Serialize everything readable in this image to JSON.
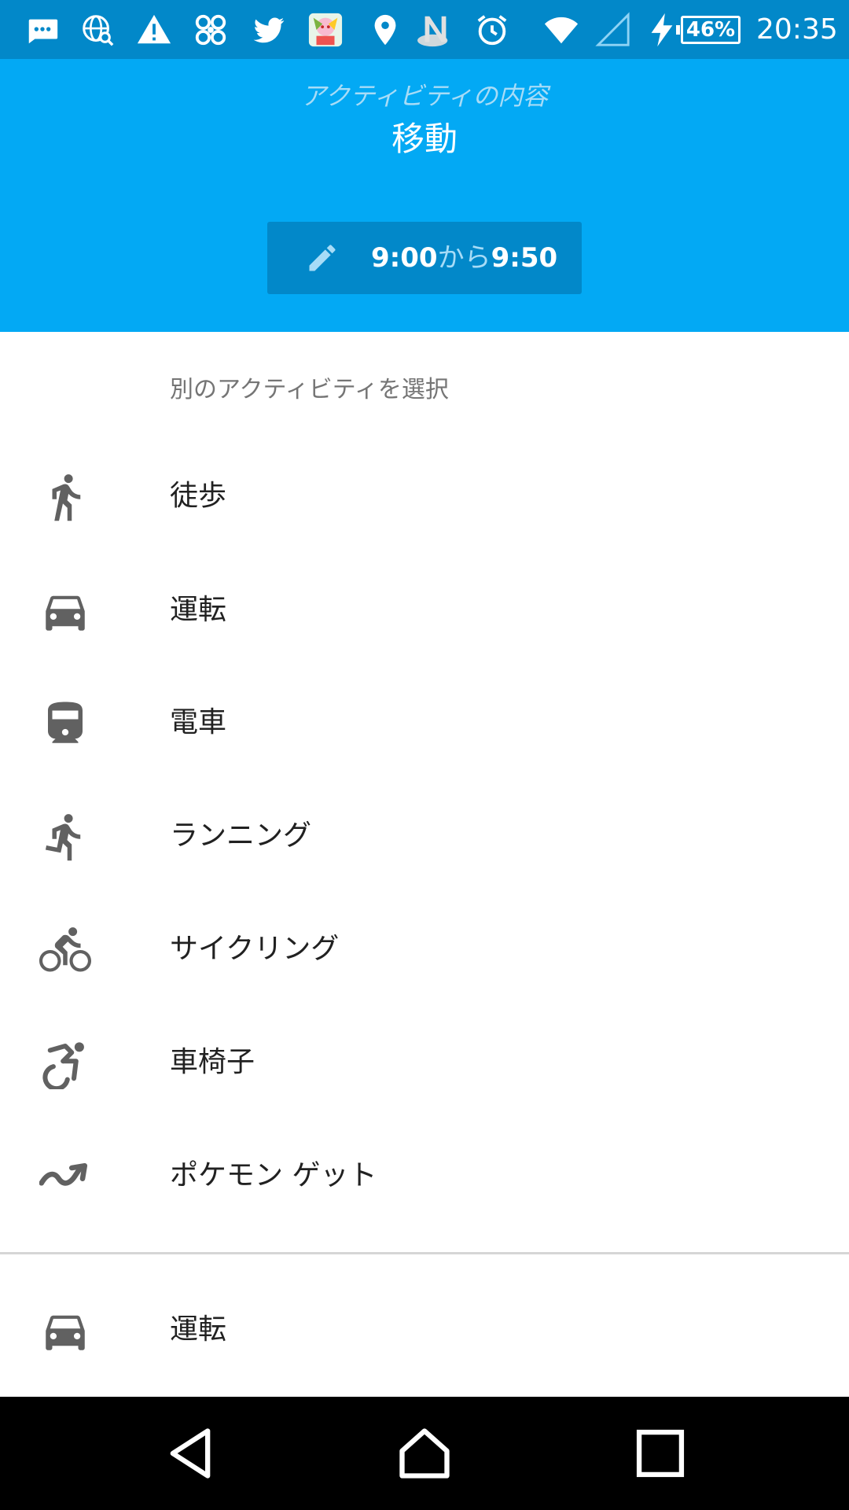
{
  "status_bar": {
    "icons": [
      "messages-icon",
      "globe-search-icon",
      "warning-icon",
      "fan-icon",
      "twitter-icon",
      "game-app-icon",
      "location-pin-icon",
      "nfc-icon",
      "alarm-icon",
      "wifi-icon",
      "signal-icon",
      "charging-icon"
    ],
    "battery": "46%",
    "time": "20:35"
  },
  "header": {
    "subtitle": "アクティビティの内容",
    "title": "移動",
    "time_start": "9:00",
    "time_separator": "から",
    "time_end": "9:50"
  },
  "list": {
    "section_label": "別のアクティビティを選択",
    "items": [
      {
        "label": "徒歩",
        "icon": "walking-icon"
      },
      {
        "label": "運転",
        "icon": "car-icon"
      },
      {
        "label": "電車",
        "icon": "train-icon"
      },
      {
        "label": "ランニング",
        "icon": "running-icon"
      },
      {
        "label": "サイクリング",
        "icon": "bicycle-icon"
      },
      {
        "label": "車椅子",
        "icon": "wheelchair-icon"
      },
      {
        "label": "ポケモン ゲット",
        "icon": "trending-icon"
      }
    ],
    "bottom_item": {
      "label": "運転",
      "icon": "car-icon"
    }
  },
  "nav_bar": {
    "buttons": [
      "back-icon",
      "home-icon",
      "recents-icon"
    ]
  },
  "colors": {
    "status_bar": "#0288c9",
    "header": "#03a9f4",
    "time_button": "#0288c9",
    "icon_gray": "#616161"
  }
}
